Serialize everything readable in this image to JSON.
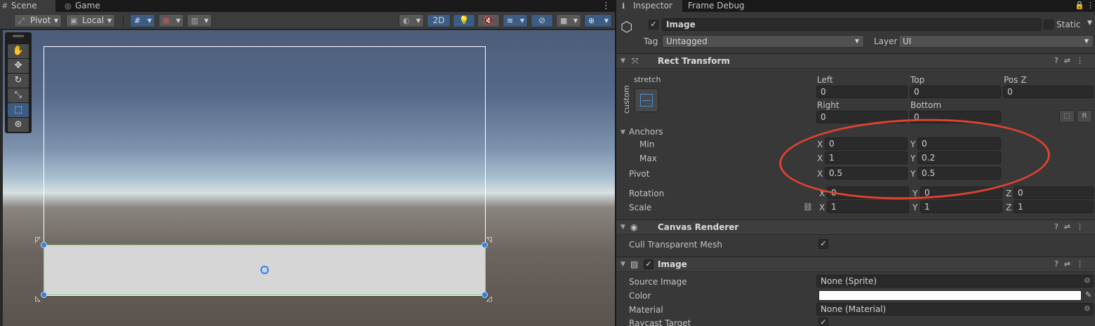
{
  "scene": {
    "tabs": [
      "Scene",
      "Game"
    ],
    "toolbar": {
      "pivot_label": "Pivot",
      "local_label": "Local",
      "mode_2d_label": "2D"
    }
  },
  "inspector": {
    "tabs": [
      "Inspector",
      "Frame Debug"
    ],
    "object": {
      "name": "Image",
      "static_label": "Static",
      "tag_label": "Tag",
      "tag_value": "Untagged",
      "layer_label": "Layer",
      "layer_value": "UI"
    },
    "rect_transform": {
      "title": "Rect Transform",
      "preset_label": "stretch",
      "side_label": "custom",
      "left_label": "Left",
      "left": "0",
      "top_label": "Top",
      "top": "0",
      "posz_label": "Pos Z",
      "posz": "0",
      "right_label": "Right",
      "right": "0",
      "bottom_label": "Bottom",
      "bottom": "0",
      "r_button": "R",
      "anchors_label": "Anchors",
      "min_label": "Min",
      "min_x": "0",
      "min_y": "0",
      "max_label": "Max",
      "max_x": "1",
      "max_y": "0.2",
      "pivot_label": "Pivot",
      "pivot_x": "0.5",
      "pivot_y": "0.5",
      "rotation_label": "Rotation",
      "rot_x": "0",
      "rot_y": "0",
      "rot_z": "0",
      "scale_label": "Scale",
      "scale_x": "1",
      "scale_y": "1",
      "scale_z": "1",
      "axis_x": "X",
      "axis_y": "Y",
      "axis_z": "Z"
    },
    "canvas_renderer": {
      "title": "Canvas Renderer",
      "cull_label": "Cull Transparent Mesh"
    },
    "image": {
      "title": "Image",
      "source_label": "Source Image",
      "source_value": "None (Sprite)",
      "color_label": "Color",
      "color_value": "#ffffff",
      "material_label": "Material",
      "material_value": "None (Material)",
      "raycast_label": "Raycast Target"
    }
  }
}
